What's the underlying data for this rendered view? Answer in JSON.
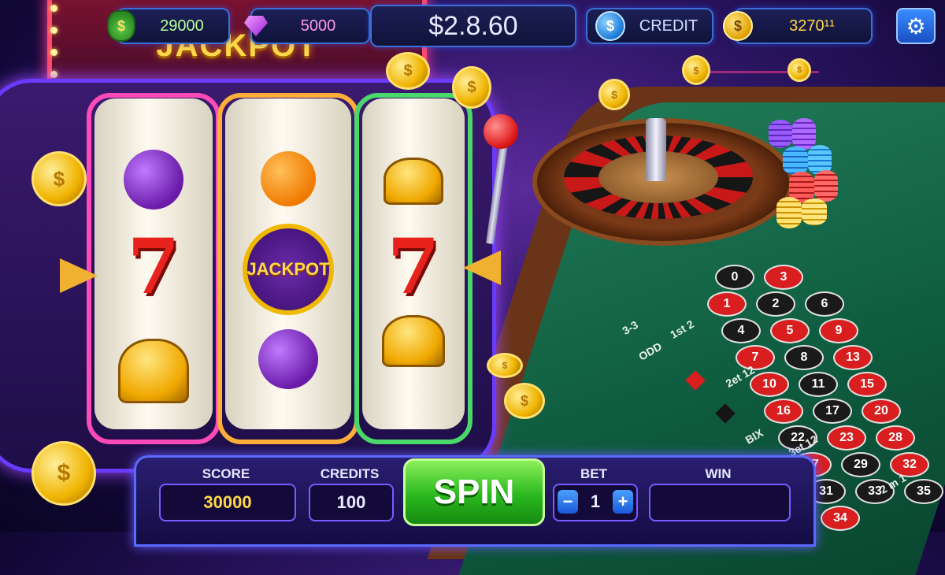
{
  "hud": {
    "cash": "29000",
    "gems": "5000",
    "balance": "$2.8.60",
    "credit_label": "CREDIT",
    "coins": "3270¹¹"
  },
  "marquee": {
    "title": "JACKPOT"
  },
  "reels": {
    "badge": "JACKPOT",
    "seven": "7"
  },
  "table": {
    "numbers": [
      {
        "n": "0",
        "c": "b"
      },
      {
        "n": "3",
        "c": "r"
      },
      {
        "n": "1",
        "c": "r"
      },
      {
        "n": "2",
        "c": "b"
      },
      {
        "n": "6",
        "c": "b"
      },
      {
        "n": "4",
        "c": "b"
      },
      {
        "n": "5",
        "c": "r"
      },
      {
        "n": "9",
        "c": "r"
      },
      {
        "n": "7",
        "c": "r"
      },
      {
        "n": "8",
        "c": "b"
      },
      {
        "n": "13",
        "c": "r"
      },
      {
        "n": "10",
        "c": "r"
      },
      {
        "n": "11",
        "c": "b"
      },
      {
        "n": "15",
        "c": "r"
      },
      {
        "n": "16",
        "c": "r"
      },
      {
        "n": "17",
        "c": "b"
      },
      {
        "n": "20",
        "c": "r"
      },
      {
        "n": "22",
        "c": "b"
      },
      {
        "n": "23",
        "c": "r"
      },
      {
        "n": "28",
        "c": "r"
      },
      {
        "n": "27",
        "c": "r"
      },
      {
        "n": "29",
        "c": "b"
      },
      {
        "n": "32",
        "c": "r"
      },
      {
        "n": "31",
        "c": "b"
      },
      {
        "n": "33",
        "c": "b"
      },
      {
        "n": "35",
        "c": "b"
      },
      {
        "n": "34",
        "c": "r"
      }
    ],
    "labels": [
      "3-3",
      "1st 2",
      "ODD",
      "2et 12",
      "BIX",
      "3et 12",
      "2 m 1"
    ]
  },
  "panel": {
    "score_label": "SCORE",
    "score_value": "30000",
    "credits_label": "CREDITS",
    "credits_value": "100",
    "spin_label": "SPIN",
    "bet_label": "BET",
    "bet_value": "1",
    "bet_minus": "−",
    "bet_plus": "+",
    "win_label": "WIN",
    "win_value": ""
  },
  "icons": {
    "coin_symbol": "$",
    "gear": "⚙"
  }
}
